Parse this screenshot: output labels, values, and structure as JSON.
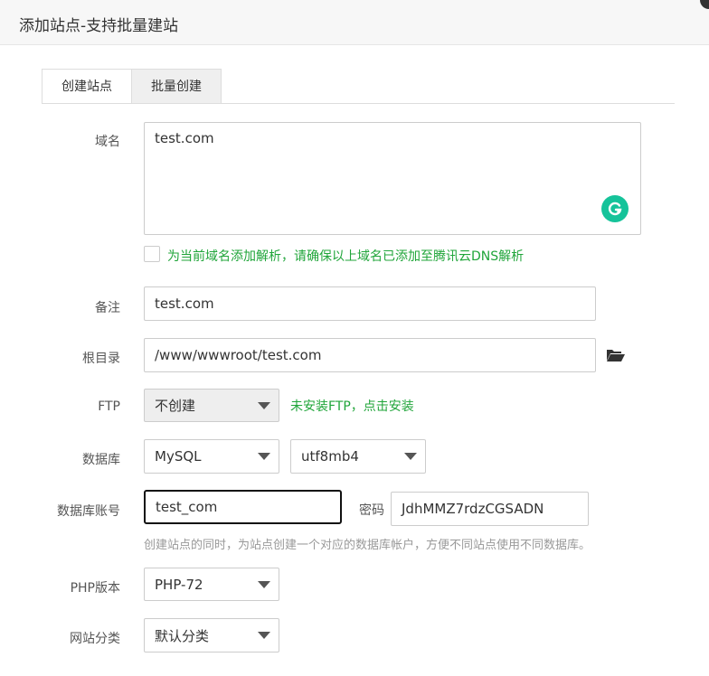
{
  "dialog": {
    "title": "添加站点-支持批量建站"
  },
  "tabs": [
    {
      "label": "创建站点",
      "active": true
    },
    {
      "label": "批量创建",
      "active": false
    }
  ],
  "form": {
    "domain": {
      "label": "域名",
      "value": "test.com"
    },
    "dns_checkbox": {
      "label": "为当前域名添加解析，请确保以上域名已添加至腾讯云DNS解析",
      "checked": false
    },
    "remark": {
      "label": "备注",
      "value": "test.com"
    },
    "root_dir": {
      "label": "根目录",
      "value": "/www/wwwroot/test.com"
    },
    "ftp": {
      "label": "FTP",
      "selected": "不创建",
      "notice": "未安装FTP，点击安装"
    },
    "database": {
      "label": "数据库",
      "type_selected": "MySQL",
      "charset_selected": "utf8mb4"
    },
    "db_account": {
      "label": "数据库账号",
      "value": "test_com",
      "password_label": "密码",
      "password_value": "JdhMMZ7rdzCGSADN",
      "hint": "创建站点的同时，为站点创建一个对应的数据库帐户，方便不同站点使用不同数据库。"
    },
    "php_version": {
      "label": "PHP版本",
      "selected": "PHP-72"
    },
    "site_category": {
      "label": "网站分类",
      "selected": "默认分类"
    }
  },
  "colors": {
    "accent_green": "#20a53a",
    "grammarly_green": "#15c39a"
  }
}
